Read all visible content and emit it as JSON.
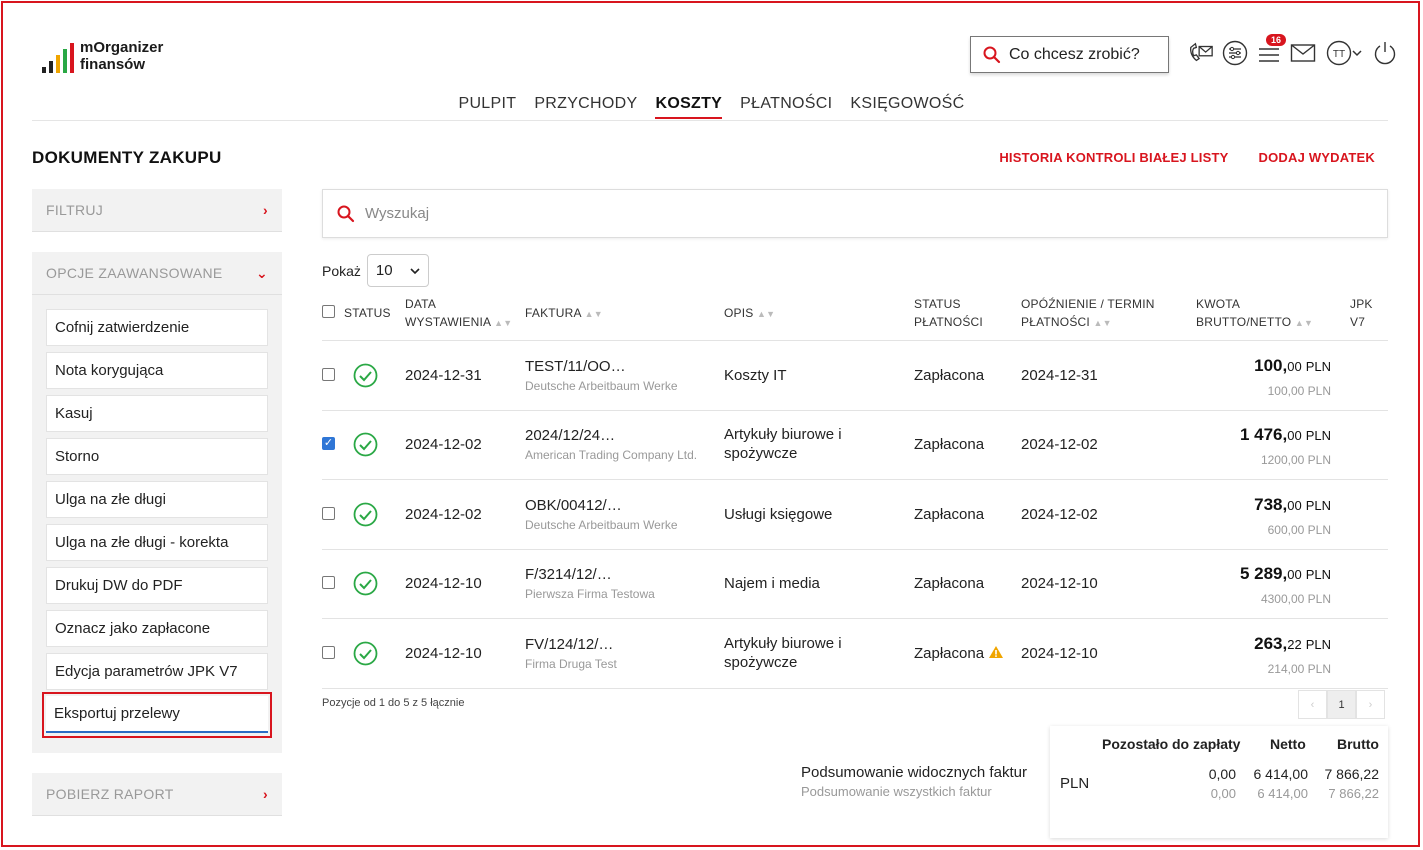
{
  "app": {
    "logo_line1": "mOrganizer",
    "logo_line2": "finansów"
  },
  "header": {
    "search_label": "Co chcesz zrobić?",
    "notification_count": "16",
    "user_initials": "TT"
  },
  "nav": {
    "tabs": [
      "PULPIT",
      "PRZYCHODY",
      "KOSZTY",
      "PŁATNOŚCI",
      "KSIĘGOWOŚĆ"
    ],
    "active": "KOSZTY"
  },
  "page": {
    "title": "DOKUMENTY ZAKUPU",
    "link_history": "HISTORIA KONTROLI BIAŁEJ LISTY",
    "link_add": "DODAJ WYDATEK"
  },
  "sidebar": {
    "filter_label": "FILTRUJ",
    "advanced_label": "OPCJE ZAAWANSOWANE",
    "report_label": "POBIERZ RAPORT",
    "actions": [
      "Cofnij zatwierdzenie",
      "Nota korygująca",
      "Kasuj",
      "Storno",
      "Ulga na złe długi",
      "Ulga na złe długi - korekta",
      "Drukuj DW do PDF",
      "Oznacz jako zapłacone",
      "Edycja parametrów JPK V7",
      "Eksportuj przelewy"
    ]
  },
  "search": {
    "placeholder": "Wyszukaj"
  },
  "show": {
    "label": "Pokaż",
    "value": "10"
  },
  "table": {
    "headers": {
      "status": "STATUS",
      "date_1": "DATA",
      "date_2": "WYSTAWIENIA",
      "invoice": "FAKTURA",
      "desc": "OPIS",
      "pay_1": "STATUS",
      "pay_2": "PŁATNOŚCI",
      "due_1": "OPÓŹNIENIE / TERMIN",
      "due_2": "PŁATNOŚCI",
      "amount_1": "KWOTA",
      "amount_2": "BRUTTO/NETTO",
      "jpk_1": "JPK",
      "jpk_2": "V7"
    },
    "rows": [
      {
        "checked": false,
        "date": "2024-12-31",
        "invoice": "TEST/11/OO…",
        "company": "Deutsche Arbeitbaum Werke",
        "desc_1": "Koszty IT",
        "desc_2": "",
        "pay_status": "Zapłacona",
        "warning": false,
        "due": "2024-12-31",
        "gross_int": "100,",
        "gross_dec": "00",
        "currency": "PLN",
        "net": "100,00 PLN"
      },
      {
        "checked": true,
        "date": "2024-12-02",
        "invoice": "2024/12/24…",
        "company": "American Trading Company Ltd.",
        "desc_1": "Artykuły biurowe i",
        "desc_2": "spożywcze",
        "pay_status": "Zapłacona",
        "warning": false,
        "due": "2024-12-02",
        "gross_int": "1 476,",
        "gross_dec": "00",
        "currency": "PLN",
        "net": "1200,00 PLN"
      },
      {
        "checked": false,
        "date": "2024-12-02",
        "invoice": "OBK/00412/…",
        "company": "Deutsche Arbeitbaum Werke",
        "desc_1": "Usługi księgowe",
        "desc_2": "",
        "pay_status": "Zapłacona",
        "warning": false,
        "due": "2024-12-02",
        "gross_int": "738,",
        "gross_dec": "00",
        "currency": "PLN",
        "net": "600,00 PLN"
      },
      {
        "checked": false,
        "date": "2024-12-10",
        "invoice": "F/3214/12/…",
        "company": "Pierwsza Firma Testowa",
        "desc_1": "Najem i media",
        "desc_2": "",
        "pay_status": "Zapłacona",
        "warning": false,
        "due": "2024-12-10",
        "gross_int": "5 289,",
        "gross_dec": "00",
        "currency": "PLN",
        "net": "4300,00 PLN"
      },
      {
        "checked": false,
        "date": "2024-12-10",
        "invoice": "FV/124/12/…",
        "company": "Firma Druga Test",
        "desc_1": "Artykuły biurowe i",
        "desc_2": "spożywcze",
        "pay_status": "Zapłacona",
        "warning": true,
        "due": "2024-12-10",
        "gross_int": "263,",
        "gross_dec": "22",
        "currency": "PLN",
        "net": "214,00 PLN"
      }
    ]
  },
  "footer": {
    "positions": "Pozycje od 1 do 5 z 5 łącznie",
    "page": "1",
    "summary_visible": "Podsumowanie widocznych faktur",
    "summary_all": "Podsumowanie wszystkich faktur",
    "col_remaining": "Pozostało do zapłaty",
    "col_net": "Netto",
    "col_gross": "Brutto",
    "currency": "PLN",
    "visible_remaining": "0,00",
    "visible_net": "6 414,00",
    "visible_gross": "7 866,22",
    "all_remaining": "0,00",
    "all_net": "6 414,00",
    "all_gross": "7 866,22"
  },
  "colors": {
    "accent": "#d8151e",
    "ok_green": "#2aa845",
    "checkbox_blue": "#2f76d6",
    "warning": "#f0a500"
  }
}
